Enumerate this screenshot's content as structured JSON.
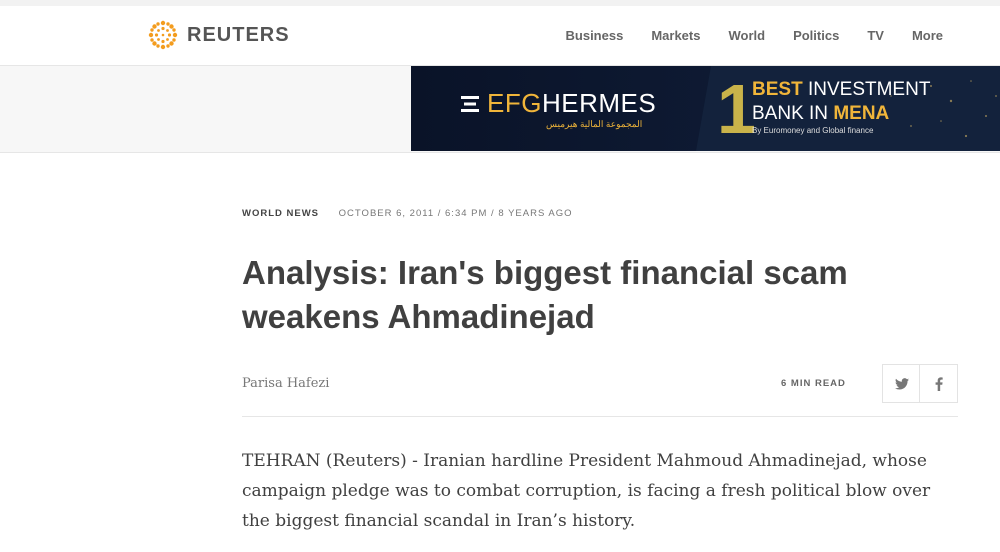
{
  "header": {
    "logo_text": "REUTERS",
    "nav": [
      "Business",
      "Markets",
      "World",
      "Politics",
      "TV",
      "More"
    ]
  },
  "ad": {
    "brand_prefix": "EFG",
    "brand_suffix": "HERMES",
    "arabic_tagline": "المجموعة المالية هيرميس",
    "rank": "1",
    "line1_strong": "BEST",
    "line1_rest": "INVESTMENT",
    "line2_rest": "BANK IN",
    "line2_strong": "MENA",
    "line3": "By Euromoney and Global finance",
    "accent_color": "#f0b53a"
  },
  "article": {
    "section": "WORLD NEWS",
    "date": "OCTOBER 6, 2011 / 6:34 PM / 8 YEARS AGO",
    "headline": "Analysis: Iran's biggest financial scam weakens Ahmadinejad",
    "author": "Parisa Hafezi",
    "read_time": "6 MIN READ",
    "share_icons": [
      "twitter-icon",
      "facebook-icon"
    ],
    "body": "TEHRAN (Reuters) - Iranian hardline President Mahmoud Ahmadinejad, whose campaign pledge was to combat corruption, is facing a fresh political blow over the biggest financial scandal in Iran’s history."
  }
}
